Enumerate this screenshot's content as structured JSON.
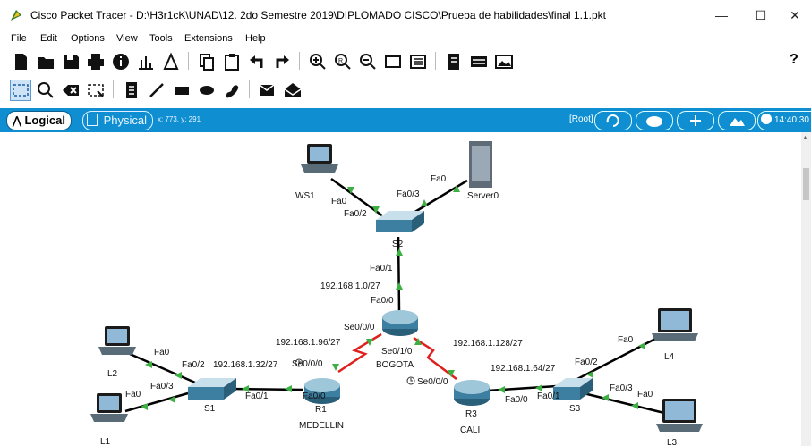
{
  "window": {
    "title": "Cisco Packet Tracer - D:\\H3r1cK\\UNAD\\12. 2do Semestre 2019\\DIPLOMADO CISCO\\Prueba de habilidades\\final 1.1.pkt",
    "minimize": "—",
    "maximize": "☐",
    "close": "✕"
  },
  "menu": [
    "File",
    "Edit",
    "Options",
    "View",
    "Tools",
    "Extensions",
    "Help"
  ],
  "toolbar": {
    "help": "?"
  },
  "tabs": {
    "logical": "Logical",
    "physical": "Physical",
    "coords": "x: 773, y: 291",
    "root": "[Root]",
    "time": "14:40:30"
  },
  "topology": {
    "devices": {
      "ws1": "WS1",
      "server0": "Server0",
      "s2": "S2",
      "bogota": "BOGOTA",
      "medellin_r": "R1",
      "medellin": "MEDELLIN",
      "cali_r": "R3",
      "cali": "CALI",
      "s1": "S1",
      "s3": "S3",
      "l1": "L1",
      "l2": "L2",
      "l3": "L3",
      "l4": "L4"
    },
    "ports": {
      "ws1_fa0": "Fa0",
      "s2_fa02": "Fa0/2",
      "s2_fa03": "Fa0/3",
      "server_fa0": "Fa0",
      "s2_fa01": "Fa0/1",
      "bog_fa00": "Fa0/0",
      "bog_se000": "Se0/0/0",
      "bog_se010": "Se0/1/0",
      "r1_se000": "Se0/0/0",
      "r1_fa00": "Fa0/0",
      "s1_fa01": "Fa0/1",
      "s1_fa02": "Fa0/2",
      "s1_fa03": "Fa0/3",
      "l2_fa0": "Fa0",
      "l1_fa0": "Fa0",
      "r3_se000": "Se0/0/0",
      "r3_fa00": "Fa0/0",
      "s3_fa01": "Fa0/1",
      "s3_fa02": "Fa0/2",
      "s3_fa03": "Fa0/3",
      "l4_fa0": "Fa0",
      "l3_fa0": "Fa0"
    },
    "networks": {
      "n0": "192.168.1.0/27",
      "n96": "192.168.1.96/27",
      "n32": "192.168.1.32/27",
      "n128": "192.168.1.128/27",
      "n64": "192.168.1.64/27"
    }
  },
  "colors": {
    "tabbar": "#0f8fd2",
    "link": "#000000",
    "serial": "#e0201c",
    "link_up": "#3cb043"
  }
}
